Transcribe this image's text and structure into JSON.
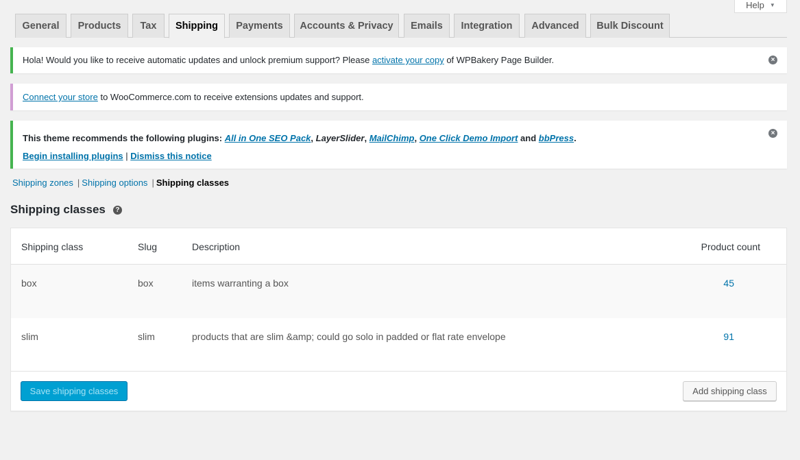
{
  "help": {
    "label": "Help",
    "caret": "▼"
  },
  "tabs": [
    {
      "label": "General"
    },
    {
      "label": "Products"
    },
    {
      "label": "Tax"
    },
    {
      "label": "Shipping",
      "active": true
    },
    {
      "label": "Payments"
    },
    {
      "label": "Accounts & Privacy"
    },
    {
      "label": "Emails"
    },
    {
      "label": "Integration"
    },
    {
      "label": "Advanced"
    },
    {
      "label": "Bulk Discount"
    }
  ],
  "notices": {
    "wpbakery": {
      "text_before": "Hola! Would you like to receive automatic updates and unlock premium support? Please ",
      "link": "activate your copy",
      "text_after": " of WPBakery Page Builder.",
      "dismiss_icon": "close-circle-icon"
    },
    "woocommerce": {
      "link": "Connect your store",
      "text_after": " to WooCommerce.com to receive extensions updates and support."
    },
    "plugins": {
      "intro": "This theme recommends the following plugins: ",
      "plugin1": "All in One SEO Pack",
      "plain": "LayerSlider",
      "plugin2": "MailChimp",
      "plugin3": "One Click Demo Import",
      "and": " and ",
      "plugin4": "bbPress",
      "comma": ", ",
      "period": ".",
      "begin_link": "Begin installing plugins",
      "pipe": " | ",
      "dismiss_link": "Dismiss this notice",
      "dismiss_icon": "close-circle-icon"
    }
  },
  "subnav": {
    "zones": "Shipping zones",
    "options": "Shipping options",
    "classes": "Shipping classes",
    "separator": "|"
  },
  "heading": {
    "title": "Shipping classes",
    "help_glyph": "?"
  },
  "table": {
    "columns": {
      "class": "Shipping class",
      "slug": "Slug",
      "description": "Description",
      "count": "Product count"
    },
    "rows": [
      {
        "class": "box",
        "slug": "box",
        "description": "items warranting a box",
        "count": "45"
      },
      {
        "class": "slim",
        "slug": "slim",
        "description": "products that are slim &amp; could go solo in padded or flat rate envelope",
        "count": "91"
      }
    ]
  },
  "footer": {
    "save_label": "Save shipping classes",
    "add_label": "Add shipping class"
  },
  "colors": {
    "accent": "#0073aa",
    "primary_button": "#00a0d2",
    "notice_green": "#46b450",
    "notice_purple": "#d19ed4"
  }
}
